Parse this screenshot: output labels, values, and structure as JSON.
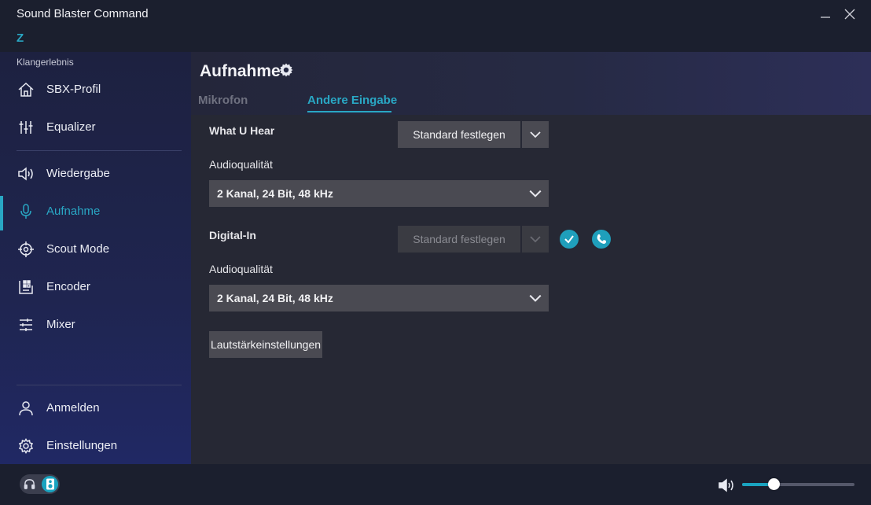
{
  "app": {
    "title": "Sound Blaster Command",
    "device_letter": "Z"
  },
  "sidebar": {
    "section_label": "Klangerlebnis",
    "items": [
      {
        "label": "SBX-Profil",
        "icon": "home-icon"
      },
      {
        "label": "Equalizer",
        "icon": "equalizer-sliders-icon"
      },
      {
        "label": "Wiedergabe",
        "icon": "speaker-icon"
      },
      {
        "label": "Aufnahme",
        "icon": "microphone-icon",
        "active": true
      },
      {
        "label": "Scout Mode",
        "icon": "crosshair-icon"
      },
      {
        "label": "Encoder",
        "icon": "encoder-icon"
      },
      {
        "label": "Mixer",
        "icon": "mixer-sliders-icon"
      }
    ],
    "bottom_items": [
      {
        "label": "Anmelden",
        "icon": "user-icon"
      },
      {
        "label": "Einstellungen",
        "icon": "gear-icon"
      }
    ]
  },
  "main": {
    "title": "Aufnahme",
    "tabs": [
      {
        "label": "Mikrofon",
        "active": false
      },
      {
        "label": "Andere Eingabe",
        "active": true
      }
    ],
    "what_u_hear": {
      "label": "What U Hear",
      "default_button": "Standard festlegen",
      "quality_label": "Audioqualität",
      "quality_value": "2 Kanal, 24 Bit, 48 kHz"
    },
    "digital_in": {
      "label": "Digital-In",
      "default_button": "Standard festlegen",
      "quality_label": "Audioqualität",
      "quality_value": "2 Kanal, 24 Bit, 48 kHz"
    },
    "volume_settings_button": "Lautstärkeinstellungen"
  },
  "footer": {
    "master_volume_level": 0.28
  },
  "colors": {
    "accent": "#29a7c4",
    "button": "#4a4a52",
    "panel": "#262834"
  }
}
